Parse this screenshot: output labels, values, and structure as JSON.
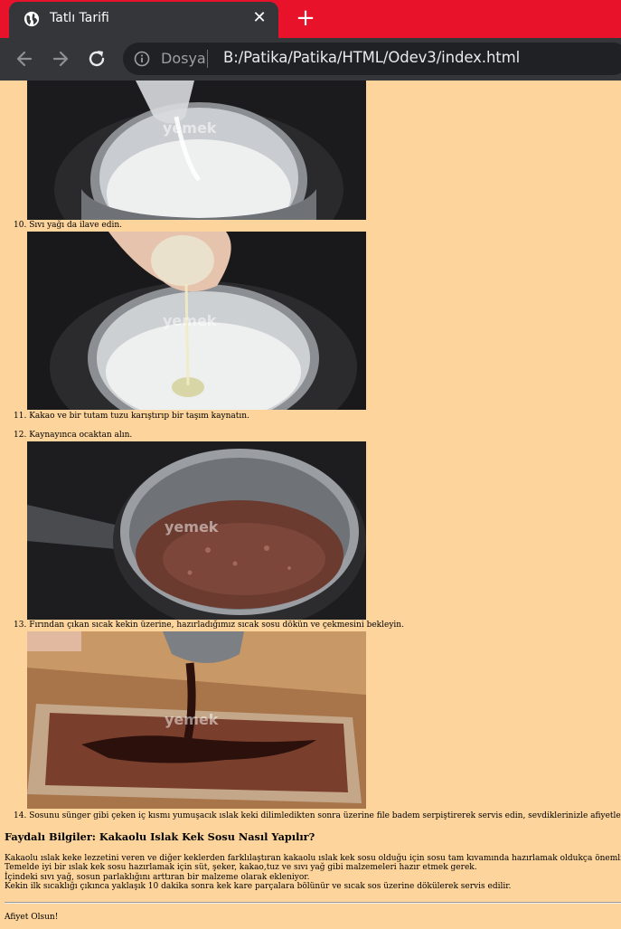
{
  "browser": {
    "tab_title": "Tatlı Tarifi",
    "close_glyph": "✕",
    "new_tab_glyph": "+",
    "url_label": "Dosya",
    "url": "B:/Patika/Patika/HTML/Odev3/index.html",
    "accent_color": "#e8132a",
    "chrome_color": "#35363a"
  },
  "page": {
    "background": "#fcd49c",
    "steps": [
      {
        "number": "10.",
        "text": "Sıvı yağı da ilave edin."
      },
      {
        "number": "11.",
        "text": "Kakao ve bir tutam tuzu karıştırıp bir taşım kaynatın."
      },
      {
        "number": "12.",
        "text": "Kaynayınca ocaktan alın."
      },
      {
        "number": "13.",
        "text": "Fırından çıkan sıcak kekin üzerine, hazırladığımız sıcak sosu dökün ve çekmesini bekleyin."
      },
      {
        "number": "14.",
        "text": "Sosunu sünger gibi çeken iç kısmı yumuşacık ıslak keki dilimledikten sonra üzerine file badem serpiştirerek servis edin, sevdiklerinizle afiyetle tüketin."
      }
    ],
    "images": [
      {
        "subject": "milk in pot with sugar",
        "watermark": "yemek"
      },
      {
        "subject": "oil poured into milk",
        "watermark": "yemek"
      },
      {
        "subject": "boiling cocoa sauce",
        "watermark": "yemek"
      },
      {
        "subject": "sauce poured on cake",
        "watermark": "yemek"
      }
    ],
    "tips_heading": "Faydalı Bilgiler: Kakaolu Islak Kek Sosu Nasıl Yapılır?",
    "tips": [
      "Kakaolu ıslak keke lezzetini veren ve diğer keklerden farklılaştıran kakaolu ıslak kek sosu olduğu için sosu tam kıvamında hazırlamak oldukça önemli.",
      "Temelde iyi bir ıslak kek sosu hazırlamak için süt, şeker, kakao,tuz ve sıvı yağ gibi malzemeleri hazır etmek gerek.",
      "İçindeki sıvı yağ, sosun parlaklığını arttıran bir malzeme olarak ekleniyor.",
      "Kekin ilk sıcaklığı çıkınca yaklaşık 10 dakika sonra kek kare parçalara bölünür ve sıcak sos üzerine dökülerek servis edilir."
    ],
    "footer": "Afiyet Olsun!"
  }
}
